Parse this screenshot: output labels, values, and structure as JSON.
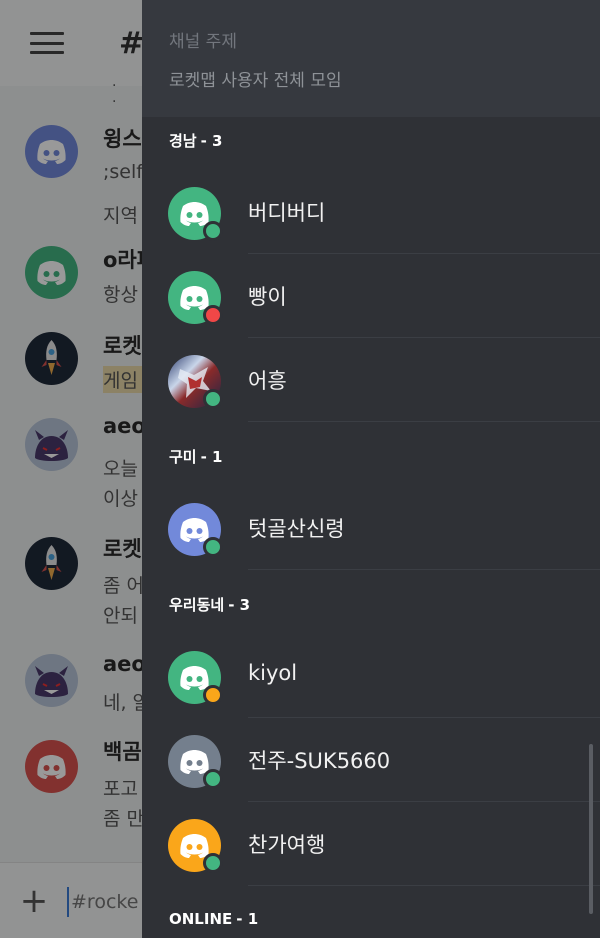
{
  "chat": {
    "channel_glyph": "#",
    "dots": "· ·",
    "input_placeholder": "#rocke",
    "plus_label": "+",
    "messages": [
      {
        "name": "윙스",
        "lines": [
          ";self",
          "지역"
        ]
      },
      {
        "name": "o라파",
        "lines": [
          "항상"
        ]
      },
      {
        "name": "로켓",
        "lines": [
          "게임"
        ],
        "highlight": true
      },
      {
        "name": "aeol",
        "lines": [
          "오늘",
          "이상"
        ]
      },
      {
        "name": "로켓",
        "lines": [
          "좀 어",
          "안되"
        ]
      },
      {
        "name": "aeol",
        "lines": [
          "네, 알"
        ]
      },
      {
        "name": "백곰",
        "lines": [
          "포고",
          "좀 만"
        ]
      }
    ]
  },
  "drawer": {
    "topic_label": "채널 주제",
    "topic_text": "로켓맵 사용자 전체 모임",
    "sections": [
      {
        "name": "경남",
        "count": "- 3",
        "members": [
          {
            "name": "버디버디",
            "avatar_color": "#43b581",
            "status": "online",
            "avatar": "discord-logo"
          },
          {
            "name": "빵이",
            "avatar_color": "#43b581",
            "status": "dnd",
            "avatar": "discord-logo"
          },
          {
            "name": "어흥",
            "avatar_color": "#5c6a9a",
            "status": "online",
            "avatar": "anime-photo"
          }
        ]
      },
      {
        "name": "구미",
        "count": "- 1",
        "members": [
          {
            "name": "텃골산신령",
            "avatar_color": "#7289da",
            "status": "online",
            "avatar": "discord-logo"
          }
        ]
      },
      {
        "name": "우리동네",
        "count": "- 3",
        "members": [
          {
            "name": "kiyol",
            "avatar_color": "#43b581",
            "status": "idle",
            "avatar": "discord-logo"
          },
          {
            "name": "전주-SUK5660",
            "avatar_color": "#747f8d",
            "status": "online",
            "avatar": "discord-logo"
          },
          {
            "name": "찬가여행",
            "avatar_color": "#faa61a",
            "status": "online",
            "avatar": "discord-logo"
          }
        ]
      },
      {
        "name": "ONLINE",
        "count": "- 1",
        "members": []
      }
    ]
  },
  "colors": {
    "online": "#43b581",
    "dnd": "#f04747",
    "idle": "#faa61a"
  }
}
